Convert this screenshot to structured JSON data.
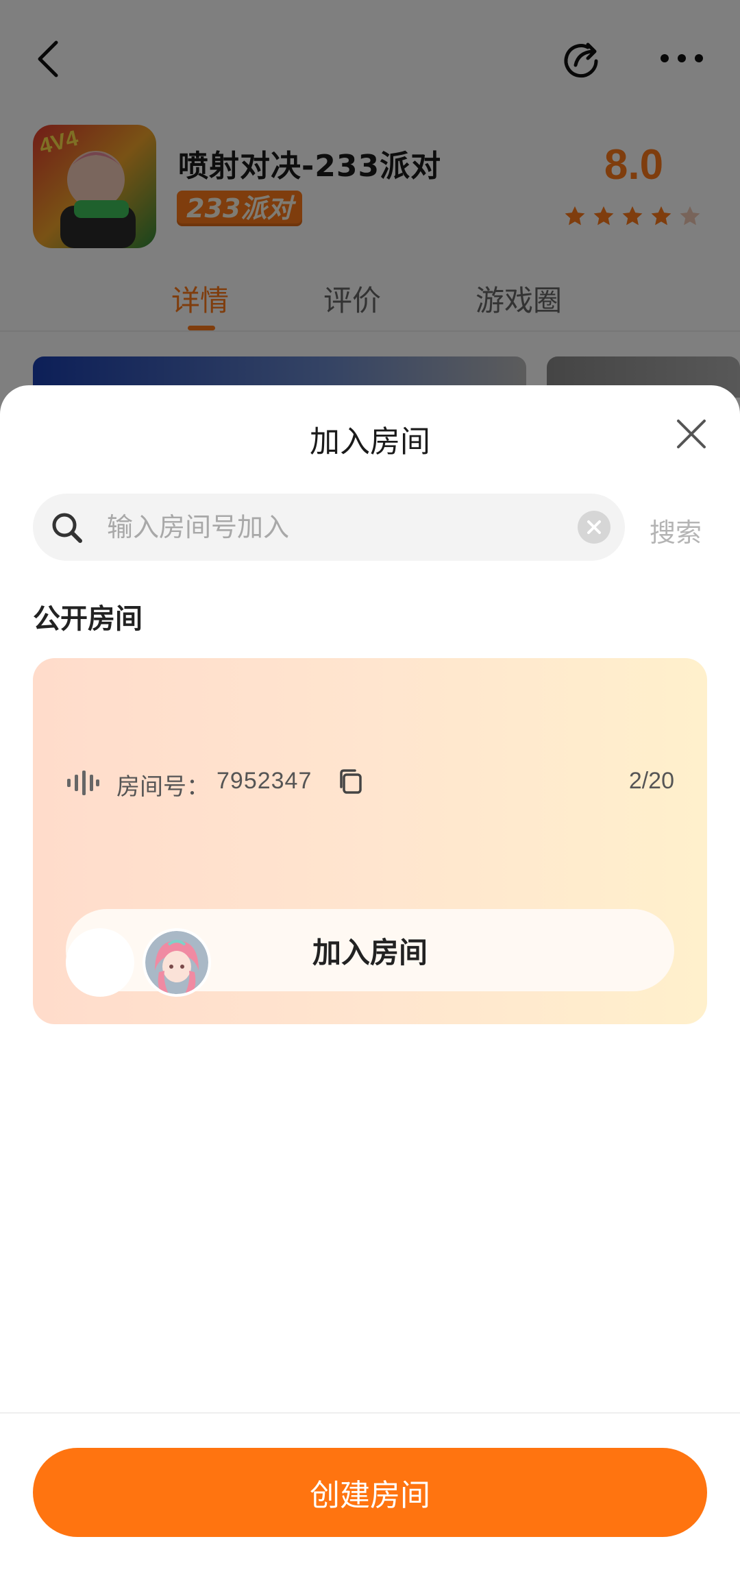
{
  "game": {
    "title": "喷射对决-233派对",
    "badge": "233派对",
    "rating": "8.0",
    "stars_filled": 4
  },
  "tabs": [
    {
      "label": "详情",
      "active": true
    },
    {
      "label": "评价",
      "active": false
    },
    {
      "label": "游戏圈",
      "active": false
    }
  ],
  "sheet": {
    "title": "加入房间",
    "search": {
      "placeholder": "输入房间号加入",
      "button": "搜索"
    },
    "section_title": "公开房间",
    "room": {
      "number_label": "房间号：",
      "number": "7952347",
      "count": "2/20",
      "join_label": "加入房间"
    },
    "create_label": "创建房间"
  },
  "colors": {
    "accent": "#ff7410",
    "dim_overlay": "rgba(0,0,0,0.5)"
  },
  "icons": [
    "back-arrow-icon",
    "share-icon",
    "more-icon",
    "star-icon",
    "close-icon",
    "search-icon",
    "clear-icon",
    "voice-wave-icon",
    "copy-icon"
  ]
}
